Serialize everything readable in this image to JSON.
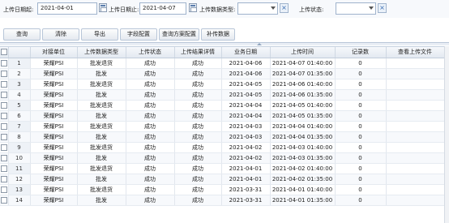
{
  "filters": {
    "start_label": "上传日期起:",
    "start_value": "2021-04-01",
    "end_label": "上传日期止:",
    "end_value": "2021-04-07",
    "type_label": "上传数据类型:",
    "type_value": "",
    "status_label": "上传状态:",
    "status_value": ""
  },
  "toolbar": {
    "query": "查询",
    "clear": "清除",
    "export": "导出",
    "field_config": "字段配置",
    "query_plan": "查询方案配置",
    "resend": "补传数据"
  },
  "columns": [
    "",
    "",
    "对接单位",
    "上传数据类型",
    "上传状态",
    "上传结果详情",
    "业务日期",
    "上传时间",
    "记录数",
    "查看上传文件"
  ],
  "rows": [
    {
      "n": "1",
      "unit": "荣耀PSI",
      "type": "批发退货",
      "status": "成功",
      "detail": "成功",
      "bizdate": "2021-04-06",
      "uptime": "2021-04-07 01:40:00",
      "count": "0",
      "file": ""
    },
    {
      "n": "2",
      "unit": "荣耀PSI",
      "type": "批发",
      "status": "成功",
      "detail": "成功",
      "bizdate": "2021-04-06",
      "uptime": "2021-04-07 01:35:00",
      "count": "0",
      "file": ""
    },
    {
      "n": "3",
      "unit": "荣耀PSI",
      "type": "批发退货",
      "status": "成功",
      "detail": "成功",
      "bizdate": "2021-04-05",
      "uptime": "2021-04-06 01:40:00",
      "count": "0",
      "file": ""
    },
    {
      "n": "4",
      "unit": "荣耀PSI",
      "type": "批发",
      "status": "成功",
      "detail": "成功",
      "bizdate": "2021-04-05",
      "uptime": "2021-04-06 01:35:00",
      "count": "0",
      "file": ""
    },
    {
      "n": "5",
      "unit": "荣耀PSI",
      "type": "批发退货",
      "status": "成功",
      "detail": "成功",
      "bizdate": "2021-04-04",
      "uptime": "2021-04-05 01:40:00",
      "count": "0",
      "file": ""
    },
    {
      "n": "6",
      "unit": "荣耀PSI",
      "type": "批发",
      "status": "成功",
      "detail": "成功",
      "bizdate": "2021-04-04",
      "uptime": "2021-04-05 01:35:00",
      "count": "0",
      "file": ""
    },
    {
      "n": "7",
      "unit": "荣耀PSI",
      "type": "批发退货",
      "status": "成功",
      "detail": "成功",
      "bizdate": "2021-04-03",
      "uptime": "2021-04-04 01:40:00",
      "count": "0",
      "file": ""
    },
    {
      "n": "8",
      "unit": "荣耀PSI",
      "type": "批发",
      "status": "成功",
      "detail": "成功",
      "bizdate": "2021-04-03",
      "uptime": "2021-04-04 01:35:00",
      "count": "0",
      "file": ""
    },
    {
      "n": "9",
      "unit": "荣耀PSI",
      "type": "批发退货",
      "status": "成功",
      "detail": "成功",
      "bizdate": "2021-04-02",
      "uptime": "2021-04-03 01:40:00",
      "count": "0",
      "file": ""
    },
    {
      "n": "10",
      "unit": "荣耀PSI",
      "type": "批发",
      "status": "成功",
      "detail": "成功",
      "bizdate": "2021-04-02",
      "uptime": "2021-04-03 01:35:00",
      "count": "0",
      "file": ""
    },
    {
      "n": "11",
      "unit": "荣耀PSI",
      "type": "批发退货",
      "status": "成功",
      "detail": "成功",
      "bizdate": "2021-04-01",
      "uptime": "2021-04-02 01:40:00",
      "count": "0",
      "file": ""
    },
    {
      "n": "12",
      "unit": "荣耀PSI",
      "type": "批发",
      "status": "成功",
      "detail": "成功",
      "bizdate": "2021-04-01",
      "uptime": "2021-04-02 01:35:00",
      "count": "0",
      "file": ""
    },
    {
      "n": "13",
      "unit": "荣耀PSI",
      "type": "批发退货",
      "status": "成功",
      "detail": "成功",
      "bizdate": "2021-03-31",
      "uptime": "2021-04-01 01:40:00",
      "count": "0",
      "file": ""
    },
    {
      "n": "14",
      "unit": "荣耀PSI",
      "type": "批发",
      "status": "成功",
      "detail": "成功",
      "bizdate": "2021-03-31",
      "uptime": "2021-04-01 01:35:00",
      "count": "0",
      "file": ""
    }
  ],
  "icons": {
    "calendar": "calendar-icon",
    "dropdown": "chevron-down-icon",
    "clear": "close-icon"
  },
  "colors": {
    "accent": "#3b6db3",
    "header_bg": "#e3e9f1",
    "row_alt": "#f7f9fc"
  }
}
